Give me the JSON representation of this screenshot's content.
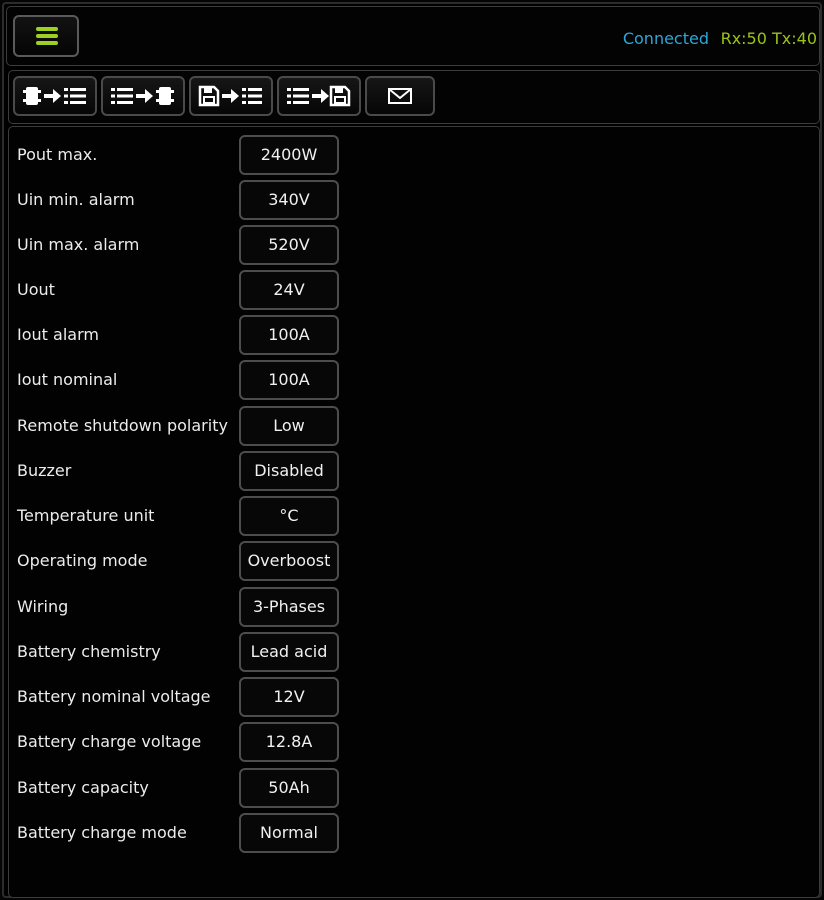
{
  "header": {
    "menu_icon": "hamburger-menu-icon",
    "menu_color": "#9fcf22",
    "connection_status": "Connected",
    "connection_color": "#2aa8d8",
    "rxtx": "Rx:50 Tx:40",
    "rxtx_color": "#9cc21a"
  },
  "toolbar": {
    "buttons": [
      {
        "icon": "device-to-list-icon"
      },
      {
        "icon": "list-to-device-icon"
      },
      {
        "icon": "file-to-list-icon"
      },
      {
        "icon": "list-to-file-icon"
      },
      {
        "icon": "envelope-icon"
      }
    ]
  },
  "settings": [
    {
      "label": "Pout max.",
      "value": "2400W"
    },
    {
      "label": "Uin min. alarm",
      "value": "340V"
    },
    {
      "label": "Uin max. alarm",
      "value": "520V"
    },
    {
      "label": "Uout",
      "value": "24V"
    },
    {
      "label": "Iout alarm",
      "value": "100A"
    },
    {
      "label": "Iout nominal",
      "value": "100A"
    },
    {
      "label": "Remote shutdown polarity",
      "value": "Low"
    },
    {
      "label": "Buzzer",
      "value": "Disabled"
    },
    {
      "label": "Temperature unit",
      "value": "°C"
    },
    {
      "label": "Operating mode",
      "value": "Overboost"
    },
    {
      "label": "Wiring",
      "value": "3-Phases"
    },
    {
      "label": "Battery chemistry",
      "value": "Lead acid"
    },
    {
      "label": "Battery nominal voltage",
      "value": "12V"
    },
    {
      "label": "Battery charge voltage",
      "value": "12.8A"
    },
    {
      "label": "Battery capacity",
      "value": "50Ah"
    },
    {
      "label": "Battery charge mode",
      "value": "Normal"
    }
  ]
}
